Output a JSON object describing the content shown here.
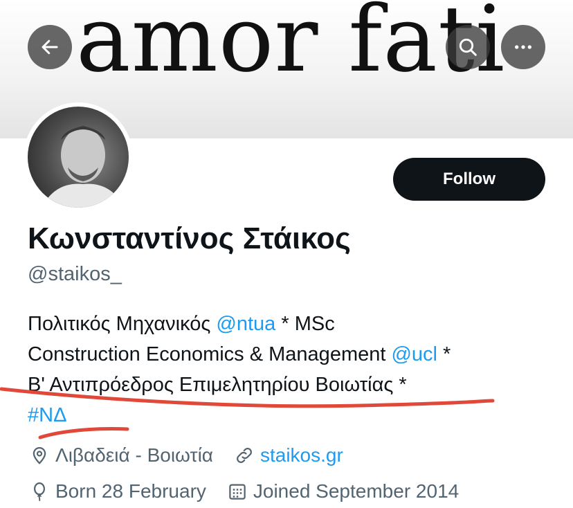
{
  "banner": {
    "text": "amor fati"
  },
  "actions": {
    "back_icon": "arrow-left-icon",
    "search_icon": "search-icon",
    "more_icon": "more-horizontal-icon",
    "follow_label": "Follow"
  },
  "profile": {
    "name": "Κωνσταντίνος Στάικος",
    "handle": "@staikos_",
    "bio": {
      "line1_a": "Πολιτικός Μηχανικός ",
      "line1_link": "@ntua",
      "line1_b": " * MSc",
      "line2_a": "Construction Economics & Management ",
      "line2_link": "@ucl",
      "line2_b": " *",
      "line3": "Β' Αντιπρόεδρος Επιμελητηρίου Βοιωτίας *",
      "line4_link": "#ΝΔ"
    },
    "location": "Λιβαδειά - Βοιωτία",
    "website": "staikos.gr",
    "birthday": "Born 28 February",
    "joined": "Joined September 2014"
  },
  "colors": {
    "link": "#1d9bf0",
    "annotation": "#e0493a",
    "muted": "#536471"
  }
}
